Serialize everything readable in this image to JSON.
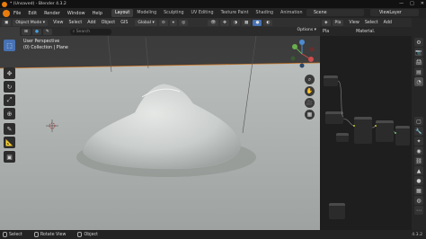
{
  "window": {
    "title": "* (Unsaved) - Blender 4.3.2"
  },
  "menu": {
    "items": [
      "File",
      "Edit",
      "Render",
      "Window",
      "Help"
    ]
  },
  "workspace_tabs": [
    "Layout",
    "Modeling",
    "Sculpting",
    "UV Editing",
    "Texture Paint",
    "Shading",
    "Animation",
    "Rende"
  ],
  "scene": {
    "label": "Scene"
  },
  "view_layer": {
    "label": "ViewLayer"
  },
  "viewport_header": {
    "mode": "Object Mode",
    "menus": [
      "View",
      "Select",
      "Add",
      "Object"
    ],
    "gis": "GIS",
    "orientation": "Global",
    "options_label": "Options"
  },
  "search": {
    "placeholder": "Search"
  },
  "viewport": {
    "view_name": "User Perspective",
    "collection": "(0) Collection | Plane"
  },
  "node_editor": {
    "header_menus": [
      "View",
      "Select",
      "Add"
    ],
    "object_label": "Pla",
    "slot_label": "Pla",
    "material_label": "Material."
  },
  "status": {
    "select": "Select",
    "rotate": "Rotate View",
    "object": "Object",
    "version": "4.3.2"
  },
  "colors": {
    "accent": "#4772b3",
    "brand": "#e87d0d",
    "background_sky": "#d9ddd9",
    "ground": "#a6aaa8"
  }
}
